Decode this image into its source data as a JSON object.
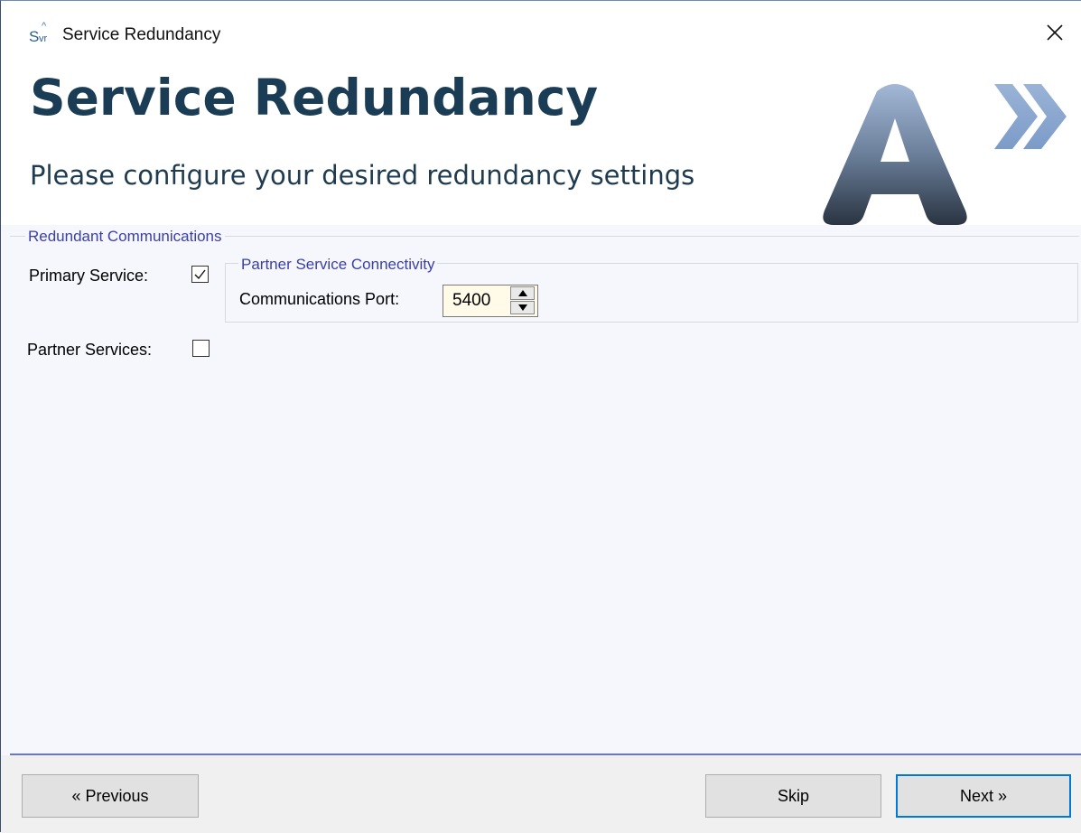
{
  "window": {
    "title": "Service Redundancy",
    "icon": "svr-app-icon",
    "icon_text": {
      "letter": "S",
      "sub": "vr",
      "accent": "^"
    }
  },
  "header": {
    "title": "Service Redundancy",
    "subtitle": "Please configure your desired redundancy settings",
    "logo": "a-chevrons-logo"
  },
  "redundancy": {
    "legend": "Redundant Communications",
    "primary_label": "Primary Service:",
    "primary_checked": true,
    "partner_label": "Partner Services:",
    "partner_checked": false
  },
  "connectivity": {
    "legend": "Partner Service Connectivity",
    "port_label": "Communications Port:",
    "port_value": "5400"
  },
  "footer": {
    "previous_label": "« Previous",
    "skip_label": "Skip",
    "next_label": "Next »"
  },
  "colors": {
    "heading": "#1a3c54",
    "legend": "#3b3fa8",
    "separator": "#6a79b9",
    "default_button_border": "#0078d7",
    "spin_bg": "#fffbe8"
  }
}
